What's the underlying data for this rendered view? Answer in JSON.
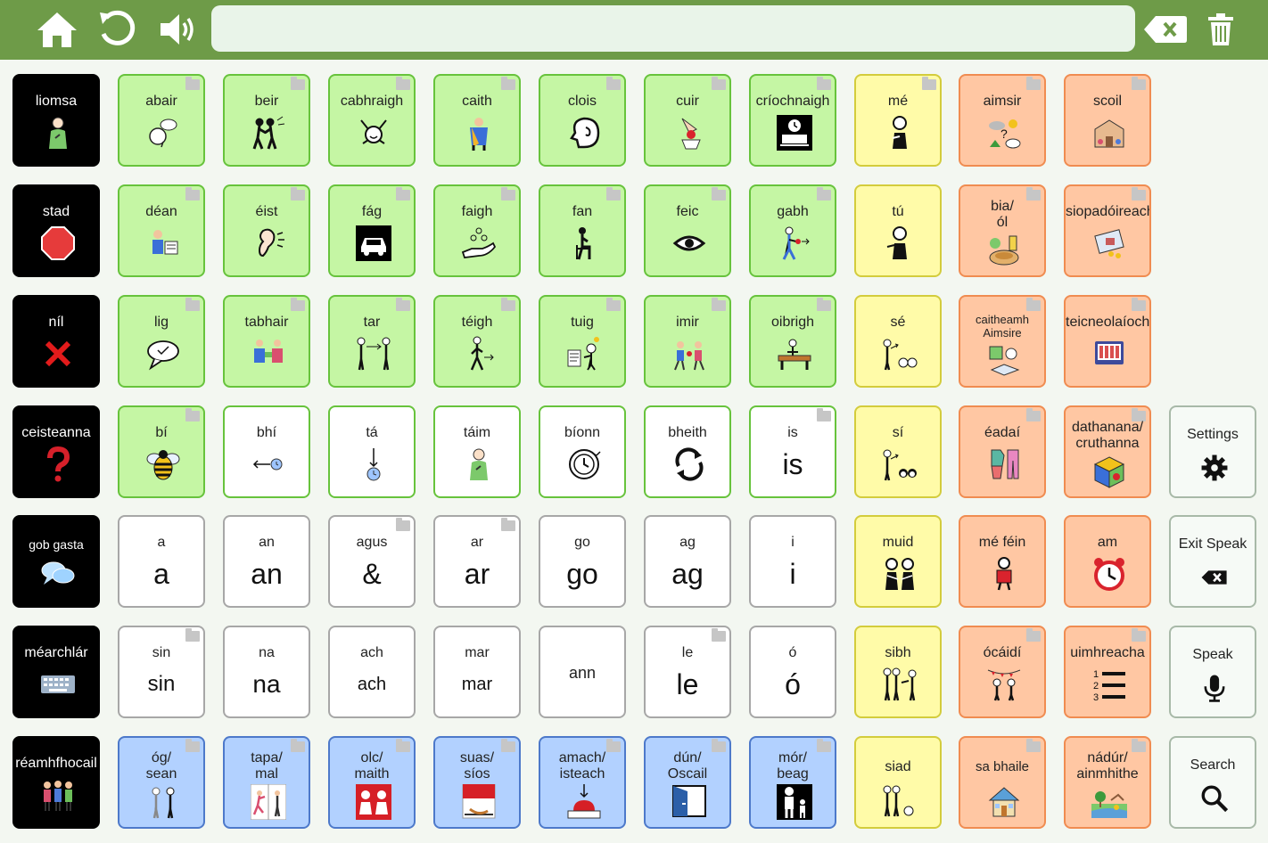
{
  "colors": {
    "topbar": "#6e9b48",
    "verbs_green": "#c5f6a4",
    "pronoun_yellow": "#fffba8",
    "noun_orange": "#ffc7a3",
    "adjective_blue": "#b2d1ff",
    "core_black": "#000000"
  },
  "toolbar": {
    "home_icon": "home-icon",
    "undo_icon": "undo-icon",
    "speaker_icon": "speaker-icon",
    "message_text": "",
    "backspace_icon": "backspace-icon",
    "clear_icon": "trash-icon"
  },
  "col0": [
    {
      "label": "liomsa",
      "icon": "me-person-icon"
    },
    {
      "label": "stad",
      "icon": "stop-sign-icon"
    },
    {
      "label": "níl",
      "icon": "red-cross-icon"
    },
    {
      "label": "ceisteanna",
      "icon": "question-mark-icon"
    },
    {
      "label": "gob gasta",
      "icon": "speech-bubbles-icon"
    },
    {
      "label": "méarchlár",
      "icon": "keyboard-icon"
    },
    {
      "label": "réamhfhocail",
      "icon": "people-group-icon"
    }
  ],
  "row1": [
    "abair",
    "beir",
    "cabhraigh",
    "caith",
    "clois",
    "cuir",
    "críochnaigh",
    "mé",
    "aimsir",
    "scoil"
  ],
  "row2": [
    "déan",
    "éist",
    "fág",
    "faigh",
    "fan",
    "feic",
    "gabh",
    "tú",
    "bia/\nól",
    "siopadóireacht"
  ],
  "row3": [
    "lig",
    "tabhair",
    "tar",
    "téigh",
    "tuig",
    "imir",
    "oibrigh",
    "sé",
    "caitheamh\nAimsire",
    "teicneolaíocht"
  ],
  "row4": [
    "bí",
    "bhí",
    "tá",
    "táim",
    "bíonn",
    "bheith",
    "is",
    "sí",
    "éadaí",
    "dathanana/\ncruthanna"
  ],
  "row4_is_big": "is",
  "row5": [
    {
      "label": "a",
      "big": "a"
    },
    {
      "label": "an",
      "big": "an"
    },
    {
      "label": "agus",
      "big": "&"
    },
    {
      "label": "ar",
      "big": "ar"
    },
    {
      "label": "go",
      "big": "go"
    },
    {
      "label": "ag",
      "big": "ag"
    },
    {
      "label": "i",
      "big": "i"
    },
    {
      "label": "muid"
    },
    {
      "label": "mé féin"
    },
    {
      "label": "am"
    }
  ],
  "row6": [
    {
      "label": "sin",
      "big": "sin"
    },
    {
      "label": "na",
      "big": "na"
    },
    {
      "label": "ach",
      "big": "ach"
    },
    {
      "label": "mar",
      "big": "mar"
    },
    {
      "label": "ann"
    },
    {
      "label": "le",
      "big": "le"
    },
    {
      "label": "ó",
      "big": "ó"
    },
    {
      "label": "sibh"
    },
    {
      "label": "ócáidí"
    },
    {
      "label": "uimhreacha"
    }
  ],
  "row7": [
    "óg/\nsean",
    "tapa/\nmal",
    "olc/\nmaith",
    "suas/\nsíos",
    "amach/\nisteach",
    "dún/\nOscail",
    "mór/\nbeag",
    "siad",
    "sa bhaile",
    "nádúr/\nainmhithe"
  ],
  "controls": [
    {
      "label": "Settings",
      "icon": "gear-icon"
    },
    {
      "label": "Exit Speak",
      "icon": "backspace-icon"
    },
    {
      "label": "Speak",
      "icon": "microphone-icon"
    },
    {
      "label": "Search",
      "icon": "search-icon"
    }
  ]
}
